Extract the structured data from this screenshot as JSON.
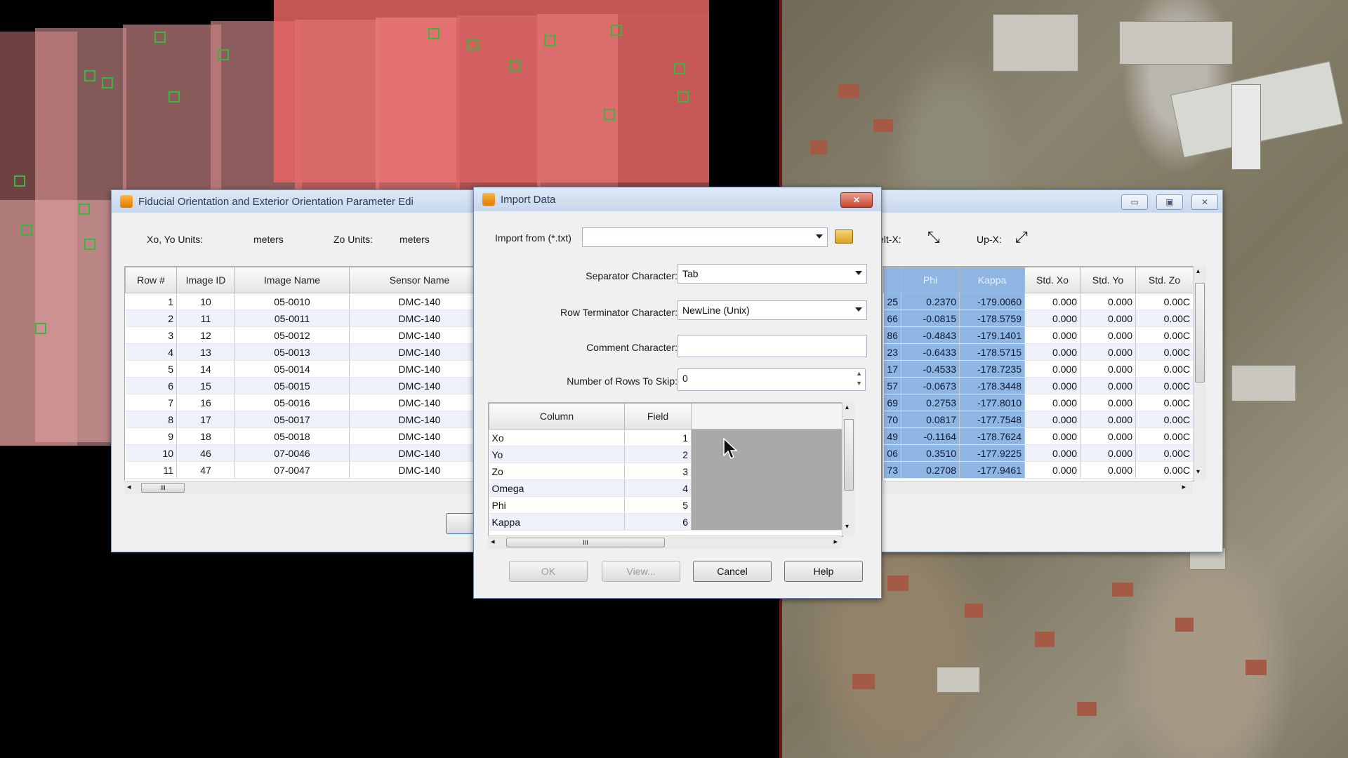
{
  "colors": {
    "accent": "#8fb6e3",
    "marker": "#3fb43f",
    "overlay_red": "#d9565b"
  },
  "fiducial_window": {
    "title": "Fiducial Orientation and Exterior Orientation Parameter Edi",
    "xy_units_label": "Xo, Yo Units:",
    "xy_units_value": "meters",
    "z_units_label": "Zo Units:",
    "z_units_value": "meters",
    "columns": [
      "Row #",
      "Image ID",
      "Image Name",
      "Sensor Name"
    ],
    "rows": [
      [
        "1",
        "10",
        "05-0010",
        "DMC-140"
      ],
      [
        "2",
        "11",
        "05-0011",
        "DMC-140"
      ],
      [
        "3",
        "12",
        "05-0012",
        "DMC-140"
      ],
      [
        "4",
        "13",
        "05-0013",
        "DMC-140"
      ],
      [
        "5",
        "14",
        "05-0014",
        "DMC-140"
      ],
      [
        "6",
        "15",
        "05-0015",
        "DMC-140"
      ],
      [
        "7",
        "16",
        "05-0016",
        "DMC-140"
      ],
      [
        "8",
        "17",
        "05-0017",
        "DMC-140"
      ],
      [
        "9",
        "18",
        "05-0018",
        "DMC-140"
      ],
      [
        "10",
        "46",
        "07-0046",
        "DMC-140"
      ],
      [
        "11",
        "47",
        "07-0047",
        "DMC-140"
      ]
    ],
    "hscroll_grip": "III"
  },
  "right_panel": {
    "toolbar_left_label": "elt-X:",
    "toolbar_right_label": "Up-X:",
    "columns": [
      "",
      "Phi",
      "Kappa",
      "Std. Xo",
      "Std. Yo",
      "Std. Zo"
    ],
    "rows": [
      [
        "25",
        "0.2370",
        "-179.0060",
        "0.000",
        "0.000",
        "0.00C"
      ],
      [
        "66",
        "-0.0815",
        "-178.5759",
        "0.000",
        "0.000",
        "0.00C"
      ],
      [
        "86",
        "-0.4843",
        "-179.1401",
        "0.000",
        "0.000",
        "0.00C"
      ],
      [
        "23",
        "-0.6433",
        "-178.5715",
        "0.000",
        "0.000",
        "0.00C"
      ],
      [
        "17",
        "-0.4533",
        "-178.7235",
        "0.000",
        "0.000",
        "0.00C"
      ],
      [
        "57",
        "-0.0673",
        "-178.3448",
        "0.000",
        "0.000",
        "0.00C"
      ],
      [
        "69",
        "0.2753",
        "-177.8010",
        "0.000",
        "0.000",
        "0.00C"
      ],
      [
        "70",
        "0.0817",
        "-177.7548",
        "0.000",
        "0.000",
        "0.00C"
      ],
      [
        "49",
        "-0.1164",
        "-178.7624",
        "0.000",
        "0.000",
        "0.00C"
      ],
      [
        "06",
        "0.3510",
        "-177.9225",
        "0.000",
        "0.000",
        "0.00C"
      ],
      [
        "73",
        "0.2708",
        "-177.9461",
        "0.000",
        "0.000",
        "0.00C"
      ]
    ]
  },
  "import_dialog": {
    "title": "Import Data",
    "close": "✕",
    "import_from_label": "Import from (*.txt)",
    "import_from_value": "",
    "separator_label": "Separator Character:",
    "separator_value": "Tab",
    "row_terminator_label": "Row Terminator Character:",
    "row_terminator_value": "NewLine (Unix)",
    "comment_label": "Comment Character:",
    "comment_value": "",
    "skip_label": "Number of Rows To Skip:",
    "skip_value": "0",
    "mapping_columns": [
      "Column",
      "Field"
    ],
    "mapping_rows": [
      [
        "Xo",
        "1"
      ],
      [
        "Yo",
        "2"
      ],
      [
        "Zo",
        "3"
      ],
      [
        "Omega",
        "4"
      ],
      [
        "Phi",
        "5"
      ],
      [
        "Kappa",
        "6"
      ]
    ],
    "hscroll_grip": "III",
    "buttons": {
      "ok": "OK",
      "view": "View...",
      "cancel": "Cancel",
      "help": "Help"
    }
  }
}
